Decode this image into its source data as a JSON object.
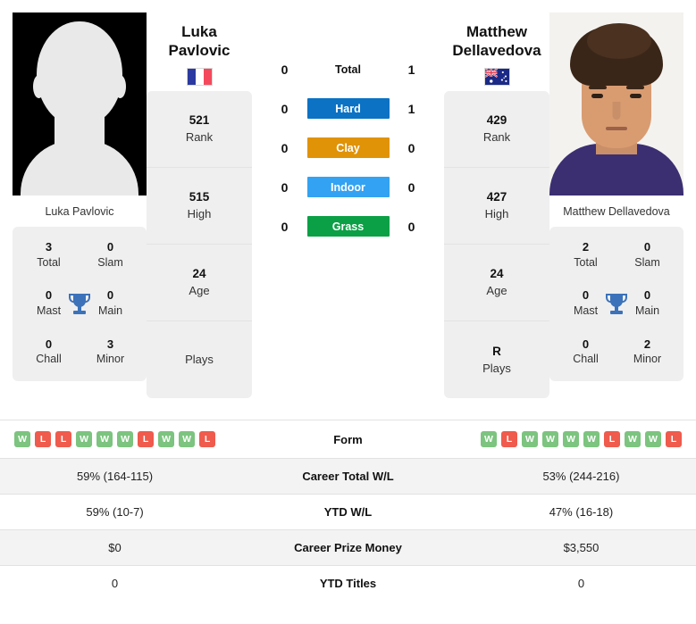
{
  "players": {
    "left": {
      "first_name": "Luka",
      "last_name": "Pavlovic",
      "full_name": "Luka Pavlovic",
      "photo_caption": "Luka Pavlovic",
      "flag": "france-flag",
      "photo_type": "placeholder-silhouette",
      "rank": "521",
      "rank_label": "Rank",
      "high": "515",
      "high_label": "High",
      "age": "24",
      "age_label": "Age",
      "plays": "",
      "plays_label": "Plays",
      "titles": {
        "total": "3",
        "total_label": "Total",
        "slam": "0",
        "slam_label": "Slam",
        "mast": "0",
        "mast_label": "Mast",
        "main": "0",
        "main_label": "Main",
        "chall": "0",
        "chall_label": "Chall",
        "minor": "3",
        "minor_label": "Minor"
      },
      "form": [
        "W",
        "L",
        "L",
        "W",
        "W",
        "W",
        "L",
        "W",
        "W",
        "L"
      ],
      "career_wl": "59% (164-115)",
      "ytd_wl": "59% (10-7)",
      "prize_money": "$0",
      "ytd_titles": "0"
    },
    "right": {
      "first_name": "Matthew",
      "last_name": "Dellavedova",
      "full_name": "Matthew Dellavedova",
      "photo_caption": "Matthew Dellavedova",
      "flag": "australia-flag",
      "photo_type": "portrait-photo",
      "rank": "429",
      "rank_label": "Rank",
      "high": "427",
      "high_label": "High",
      "age": "24",
      "age_label": "Age",
      "plays": "R",
      "plays_label": "Plays",
      "titles": {
        "total": "2",
        "total_label": "Total",
        "slam": "0",
        "slam_label": "Slam",
        "mast": "0",
        "mast_label": "Mast",
        "main": "0",
        "main_label": "Main",
        "chall": "0",
        "chall_label": "Chall",
        "minor": "2",
        "minor_label": "Minor"
      },
      "form": [
        "W",
        "L",
        "W",
        "W",
        "W",
        "W",
        "L",
        "W",
        "W",
        "L"
      ],
      "career_wl": "53% (244-216)",
      "ytd_wl": "47% (16-18)",
      "prize_money": "$3,550",
      "ytd_titles": "0"
    }
  },
  "head_to_head": {
    "rows": [
      {
        "label": "Total",
        "left": "0",
        "right": "1",
        "color": ""
      },
      {
        "label": "Hard",
        "left": "0",
        "right": "1",
        "color": "#0b72c4"
      },
      {
        "label": "Clay",
        "left": "0",
        "right": "0",
        "color": "#e09306"
      },
      {
        "label": "Indoor",
        "left": "0",
        "right": "0",
        "color": "#33a2f2"
      },
      {
        "label": "Grass",
        "left": "0",
        "right": "0",
        "color": "#0ba045"
      }
    ]
  },
  "table": {
    "rows": [
      {
        "label": "Form"
      },
      {
        "label": "Career Total W/L"
      },
      {
        "label": "YTD W/L"
      },
      {
        "label": "Career Prize Money"
      },
      {
        "label": "YTD Titles"
      }
    ]
  },
  "colors": {
    "win": "#7cc47f",
    "loss": "#ef5b4c",
    "trophy": "#3c72b9",
    "card_bg": "#efefef"
  }
}
